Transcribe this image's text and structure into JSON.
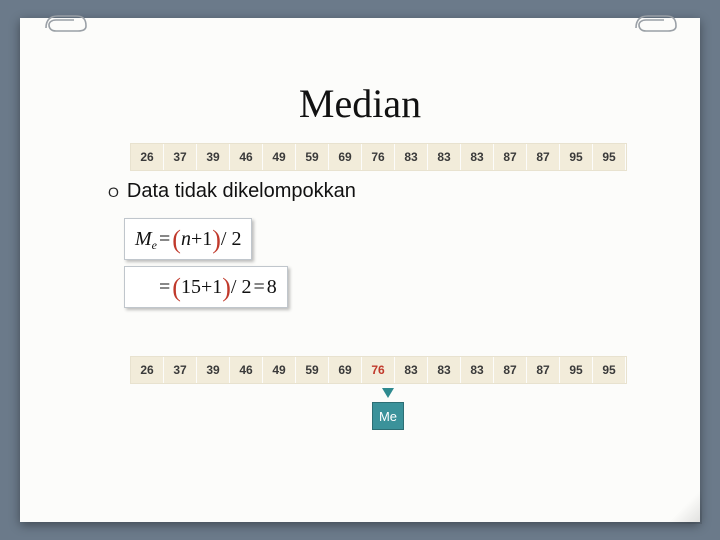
{
  "title": "Median",
  "bullet": {
    "marker": "O",
    "text": "Data tidak dikelompokkan"
  },
  "data_row": [
    "26",
    "37",
    "39",
    "46",
    "49",
    "59",
    "69",
    "76",
    "83",
    "83",
    "83",
    "87",
    "87",
    "95",
    "95"
  ],
  "highlight_index": 7,
  "formulas": {
    "f1": {
      "lhs_sym": "M",
      "lhs_sub": "e",
      "eq": "=",
      "lp": "(",
      "inside": "n",
      "plus": "+1",
      "rp": ")",
      "tail": "/ 2"
    },
    "f2": {
      "eq": "=",
      "lp": "(",
      "inside": "15",
      "plus": "+1",
      "rp": ")",
      "tail1": "/ 2",
      "eq2": "=",
      "ans": "8"
    }
  },
  "me_label": "Me"
}
